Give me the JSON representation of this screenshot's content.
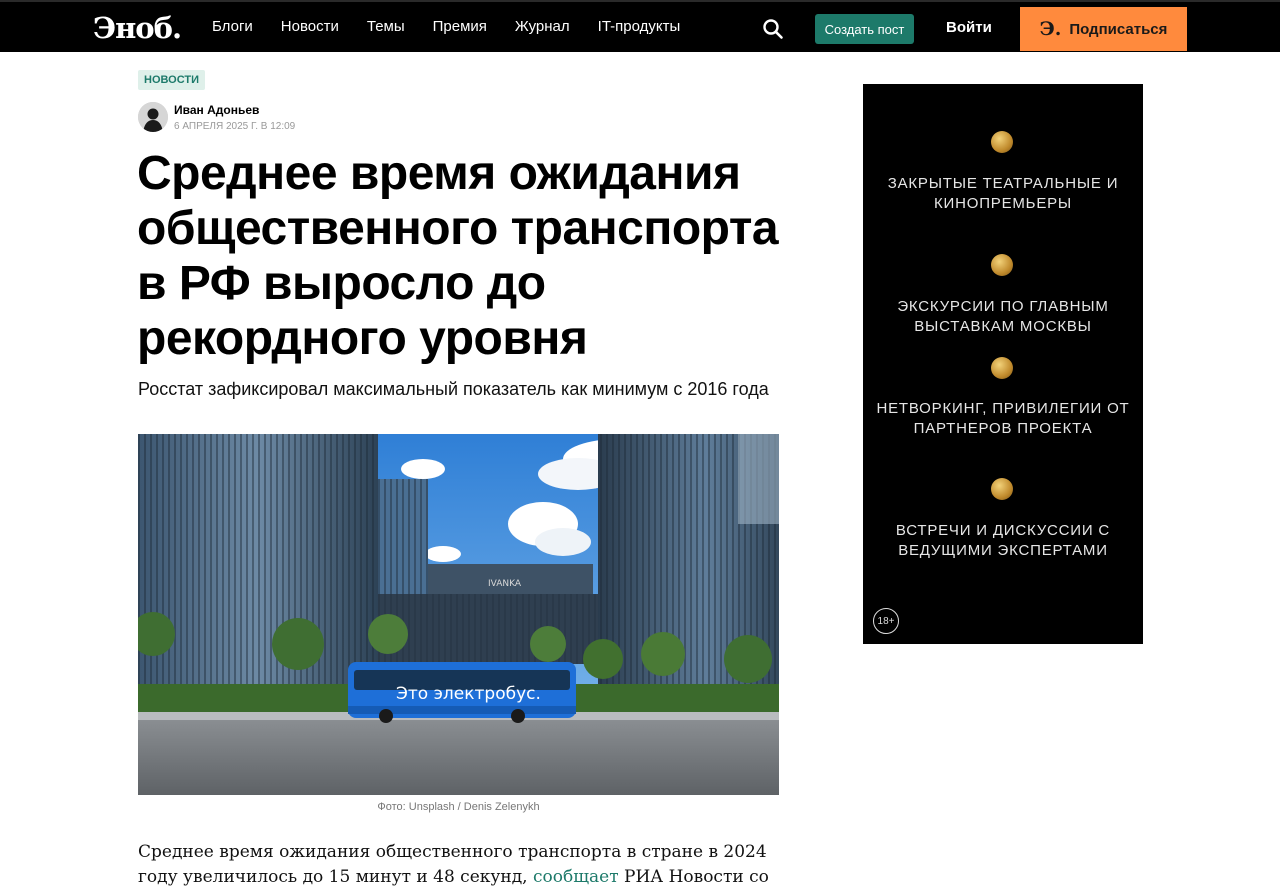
{
  "header": {
    "logo": "Эноб.",
    "nav": [
      "Блоги",
      "Новости",
      "Темы",
      "Премия",
      "Журнал",
      "IT-продукты"
    ],
    "search_icon": "search-icon",
    "create_post": "Создать пост",
    "login": "Войти",
    "subscribe_glyph": "Э.",
    "subscribe": "Подписаться",
    "colors": {
      "bar": "#000000",
      "create": "#1d7a6a",
      "subscribe": "#ff8a3d"
    }
  },
  "article": {
    "tag": "НОВОСТИ",
    "author": "Иван Адоньев",
    "date": "6 апреля 2025 г. в 12:09",
    "title": "Среднее время ожидания общественного транспорта в РФ выросло до рекордного уровня",
    "subtitle": "Росстат зафиксировал максимальный показатель как минимум с 2016 года",
    "photo": {
      "building_sign": "IVANKA",
      "bus_text": "Это электробус.",
      "caption": "Фото: Unsplash / Denis Zelenykh"
    },
    "body_before": "Среднее время ожидания общественного транспорта в стране в 2024 году увеличилось до 15 минут и 48 секунд, ",
    "body_link": "сообщает",
    "body_after": " РИА Новости со ссылкой на"
  },
  "ad": {
    "items": [
      "ЗАКРЫТЫЕ ТЕАТРАЛЬНЫЕ И КИНОПРЕМЬЕРЫ",
      "ЭКСКУРСИИ ПО ГЛАВНЫМ ВЫСТАВКАМ МОСКВЫ",
      "НЕТВОРКИНГ, ПРИВИЛЕГИИ ОТ ПАРТНЕРОВ ПРОЕКТА",
      "ВСТРЕЧИ И ДИСКУССИИ С ВЕДУЩИМИ ЭКСПЕРТАМИ"
    ],
    "age_rating": "18+"
  }
}
